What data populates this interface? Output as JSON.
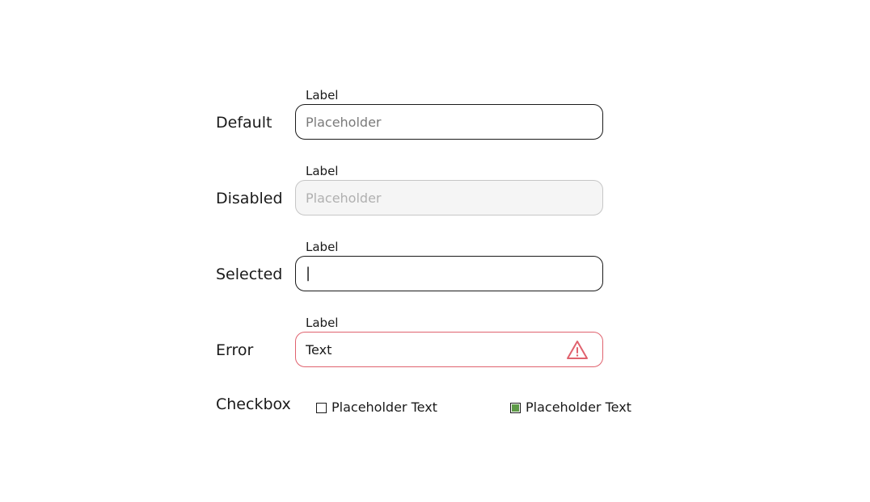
{
  "rows": {
    "default": {
      "title": "Default",
      "field_label": "Label",
      "placeholder": "Placeholder"
    },
    "disabled": {
      "title": "Disabled",
      "field_label": "Label",
      "placeholder": "Placeholder"
    },
    "selected": {
      "title": "Selected",
      "field_label": "Label",
      "caret": "|"
    },
    "error": {
      "title": "Error",
      "field_label": "Label",
      "value": "Text"
    },
    "checkbox": {
      "title": "Checkbox",
      "items": [
        {
          "label": "Placeholder Text",
          "checked": false
        },
        {
          "label": "Placeholder Text",
          "checked": true
        }
      ]
    }
  },
  "colors": {
    "error": "#e0626e",
    "checked": "#5e9a47",
    "disabled_bg": "#f5f5f5"
  },
  "icons": {
    "error": "warning-triangle-icon"
  }
}
